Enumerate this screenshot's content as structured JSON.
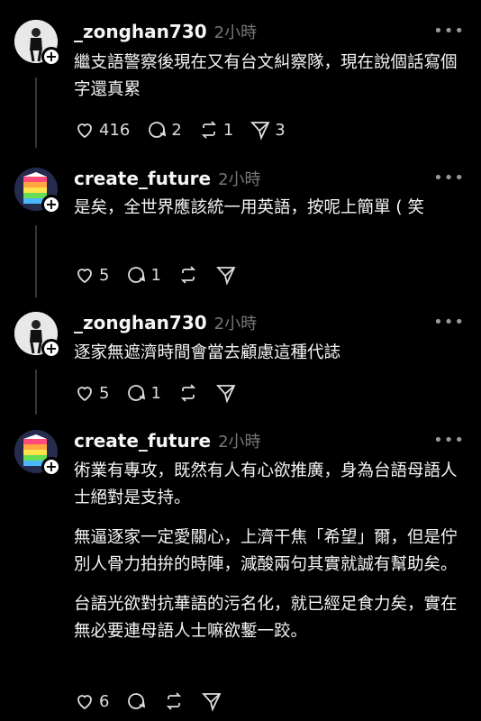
{
  "posts": [
    {
      "username": "_zonghan730",
      "time": "2小時",
      "avatar_icon": "person-photo",
      "paragraphs": [
        "繼支語警察後現在又有台文糾察隊，現在說個話寫個字還真累"
      ],
      "likes": "416",
      "replies": "2",
      "reposts": "1",
      "shares": "3"
    },
    {
      "username": "create_future",
      "time": "2小時",
      "avatar_icon": "rainbow-cake",
      "paragraphs": [
        "是矣，全世界應該統一用英語，按呢上簡單 ( 笑"
      ],
      "likes": "5",
      "replies": "1",
      "reposts": "",
      "shares": ""
    },
    {
      "username": "_zonghan730",
      "time": "2小時",
      "avatar_icon": "person-photo",
      "paragraphs": [
        "逐家無遮濟時間會當去顧慮這種代誌"
      ],
      "likes": "5",
      "replies": "1",
      "reposts": "",
      "shares": ""
    },
    {
      "username": "create_future",
      "time": "2小時",
      "avatar_icon": "rainbow-cake",
      "paragraphs": [
        "術業有專攻，既然有人有心欲推廣，身為台語母語人士絕對是支持。",
        "無逼逐家一定愛關心，上濟干焦「希望」爾，但是佇別人骨力拍拚的時陣，減酸兩句其實就誠有幫助矣。",
        "台語光欲對抗華語的污名化，就已經足食力矣，實在無必要連母語人士嘛欲鏨一跤。"
      ],
      "likes": "6",
      "replies": "",
      "reposts": "",
      "shares": ""
    }
  ],
  "colors": {
    "background": "#000000",
    "text": "#f3f5f7",
    "muted": "#777777"
  }
}
